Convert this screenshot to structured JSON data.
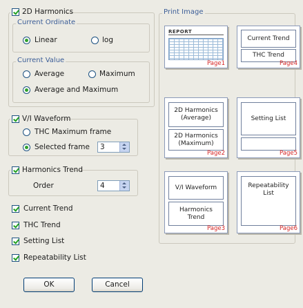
{
  "harmonics2d": {
    "label": "2D Harmonics",
    "current_ordinate": {
      "legend": "Current Ordinate",
      "options": [
        "Linear",
        "log"
      ],
      "selected": "Linear"
    },
    "current_value": {
      "legend": "Current Value",
      "options": [
        "Average",
        "Maximum",
        "Average and Maximum"
      ],
      "selected": "Average and Maximum"
    }
  },
  "vi_waveform": {
    "label": "V/I Waveform",
    "options": [
      "THC Maximum frame",
      "Selected frame"
    ],
    "selected": "Selected frame",
    "frame_value": "3"
  },
  "harmonics_trend": {
    "label": "Harmonics Trend",
    "order_label": "Order",
    "order_value": "4"
  },
  "checks": {
    "current_trend": "Current Trend",
    "thc_trend": "THC Trend",
    "setting_list": "Setting List",
    "repeatability_list": "Repeatability List"
  },
  "buttons": {
    "ok": "OK",
    "cancel": "Cancel"
  },
  "print_image": {
    "legend": "Print Image",
    "report_label": "REPORT",
    "pages": [
      {
        "page": "Page1",
        "boxes": []
      },
      {
        "page": "Page4",
        "boxes": [
          "Current Trend",
          "THC Trend"
        ]
      },
      {
        "page": "Page2",
        "boxes": [
          "2D Harmonics\n(Average)",
          "2D Harmonics\n(Maximum)"
        ]
      },
      {
        "page": "Page5",
        "boxes": [
          "Setting List"
        ]
      },
      {
        "page": "Page3",
        "boxes": [
          "V/I Waveform",
          "Harmonics\nTrend"
        ]
      },
      {
        "page": "Page6",
        "boxes": [
          "Repeatability\nList"
        ]
      }
    ]
  },
  "colors": {
    "check": "#21a121",
    "page_number": "#d42525",
    "legend": "#3b5d97"
  }
}
